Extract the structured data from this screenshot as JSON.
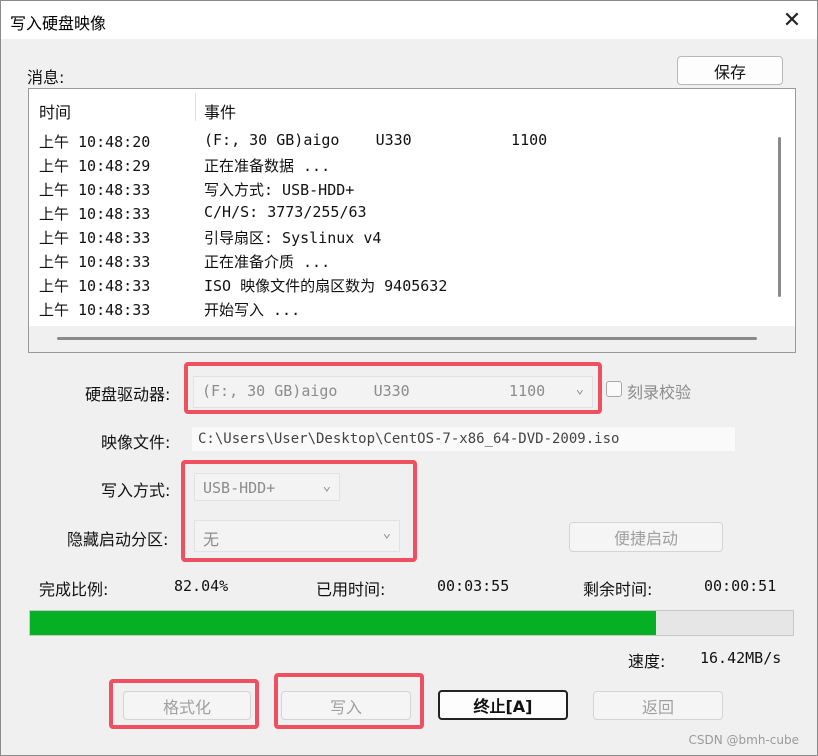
{
  "window": {
    "title": "写入硬盘映像",
    "close_glyph": "✕"
  },
  "messages": {
    "label": "消息:",
    "save_button": "保存",
    "col_time": "时间",
    "col_event": "事件",
    "rows": [
      {
        "time": "上午 10:48:20",
        "event": "(F:, 30 GB)aigo    U330           1100"
      },
      {
        "time": "上午 10:48:29",
        "event": "正在准备数据 ..."
      },
      {
        "time": "上午 10:48:33",
        "event": "写入方式: USB-HDD+"
      },
      {
        "time": "上午 10:48:33",
        "event": "C/H/S: 3773/255/63"
      },
      {
        "time": "上午 10:48:33",
        "event": "引导扇区: Syslinux v4"
      },
      {
        "time": "上午 10:48:33",
        "event": "正在准备介质 ..."
      },
      {
        "time": "上午 10:48:33",
        "event": "ISO 映像文件的扇区数为 9405632"
      },
      {
        "time": "上午 10:48:33",
        "event": "开始写入 ..."
      }
    ]
  },
  "drive": {
    "label": "硬盘驱动器:",
    "value": "(F:, 30 GB)aigo    U330           1100",
    "verify_label": "刻录校验"
  },
  "image_file": {
    "label": "映像文件:",
    "value": "C:\\Users\\User\\Desktop\\CentOS-7-x86_64-DVD-2009.iso"
  },
  "write_mode": {
    "label": "写入方式:",
    "value": "USB-HDD+"
  },
  "hidden_partition": {
    "label": "隐藏启动分区:",
    "value": "无"
  },
  "quick_boot_button": "便捷启动",
  "status": {
    "percent_label": "完成比例:",
    "percent_value": "82.04%",
    "elapsed_label": "已用时间:",
    "elapsed_value": "00:03:55",
    "remaining_label": "剩余时间:",
    "remaining_value": "00:00:51",
    "progress_fraction": 0.8204,
    "speed_label": "速度:",
    "speed_value": "16.42MB/s"
  },
  "buttons": {
    "format": "格式化",
    "write": "写入",
    "abort": "终止[A]",
    "back": "返回"
  },
  "watermark": "CSDN @bmh-cube",
  "colors": {
    "progress": "#06b025",
    "highlight": "#ef5060"
  },
  "icons": {
    "chevron": "chevron-down-icon",
    "close": "close-icon"
  }
}
